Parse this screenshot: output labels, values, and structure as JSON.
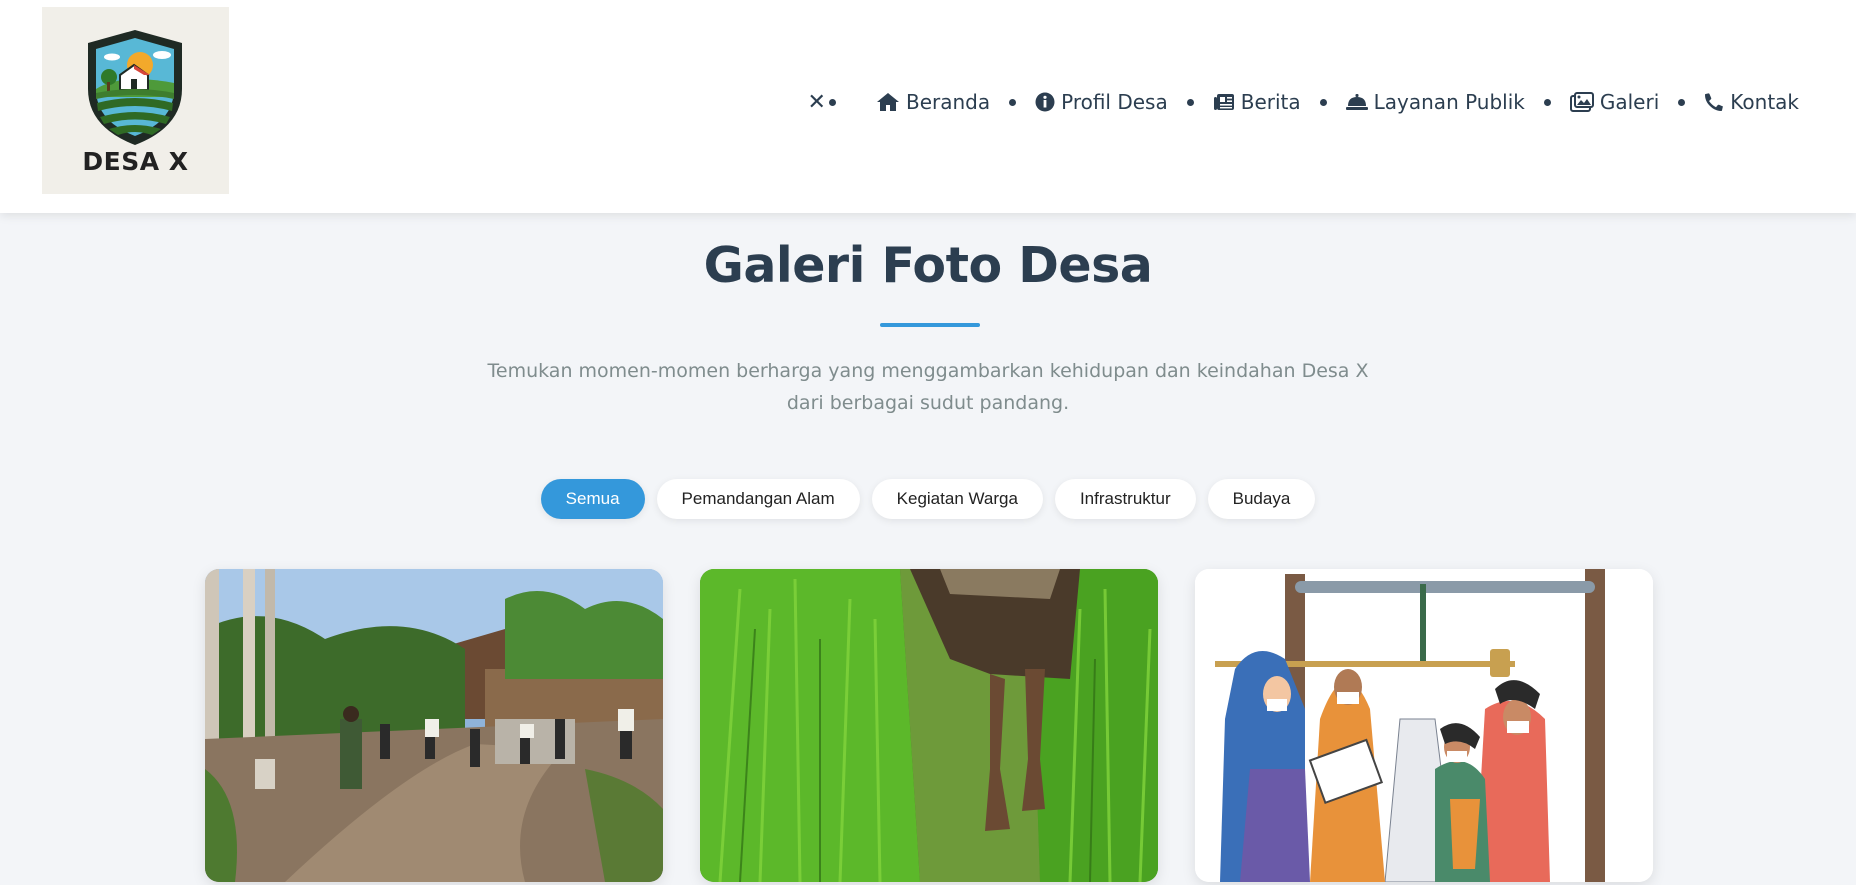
{
  "brand": {
    "logo_text": "DESA X"
  },
  "nav": {
    "toggle_label": "✕",
    "items": [
      {
        "label": "Beranda",
        "icon": "home-icon"
      },
      {
        "label": "Profil Desa",
        "icon": "info-icon"
      },
      {
        "label": "Berita",
        "icon": "newspaper-icon"
      },
      {
        "label": "Layanan Publik",
        "icon": "bell-concierge-icon"
      },
      {
        "label": "Galeri",
        "icon": "images-icon"
      },
      {
        "label": "Kontak",
        "icon": "phone-icon"
      }
    ]
  },
  "main": {
    "title": "Galeri Foto Desa",
    "subtitle": "Temukan momen-momen berharga yang menggambarkan kehidupan dan keindahan Desa X dari berbagai sudut pandang.",
    "filters": [
      {
        "label": "Semua",
        "active": true
      },
      {
        "label": "Pemandangan Alam",
        "active": false
      },
      {
        "label": "Kegiatan Warga",
        "active": false
      },
      {
        "label": "Infrastruktur",
        "active": false
      },
      {
        "label": "Budaya",
        "active": false
      }
    ]
  },
  "colors": {
    "accent": "#3498db",
    "heading": "#2c3e50",
    "muted": "#7f8c8d",
    "page_bg": "#f3f5f8"
  }
}
